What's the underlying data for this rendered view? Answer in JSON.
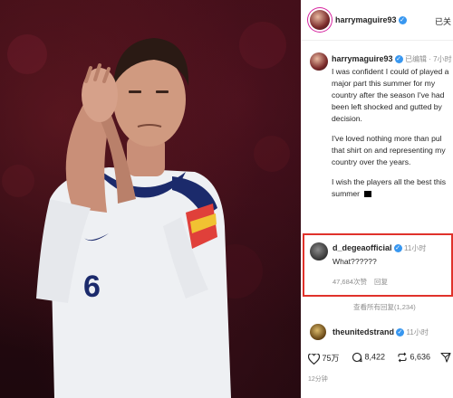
{
  "post": {
    "header": {
      "username": "harrymaguire93",
      "follow_label": "已关"
    },
    "caption": {
      "username": "harrymaguire93",
      "meta": "已编辑 · 7小时",
      "lines": [
        "I was confident I could of played a",
        "major part this summer for my",
        "country after the season I've had",
        "been left shocked and gutted by",
        "decision.",
        "",
        "I've loved nothing more than pul",
        "that shirt on and representing my",
        "country over the years.",
        "",
        "I wish the players all the best this",
        "summer"
      ]
    },
    "comments": [
      {
        "username": "d_degeaofficial",
        "time": "11小时",
        "text": "What??????",
        "likes": "47,684次赞",
        "reply": "回复"
      }
    ],
    "view_replies": "查看所有回复(1,234)",
    "second_comment": {
      "username": "theunitedstrand",
      "time": "11小时"
    },
    "actions": {
      "likes": "75万",
      "comments": "8,422",
      "reposts": "6,636"
    },
    "date": "12分钟"
  },
  "photo": {
    "shirt_number": "6"
  },
  "colors": {
    "verified": "#3897f0",
    "highlight_box": "#e0322b",
    "background_photo": "#2a0a12"
  }
}
